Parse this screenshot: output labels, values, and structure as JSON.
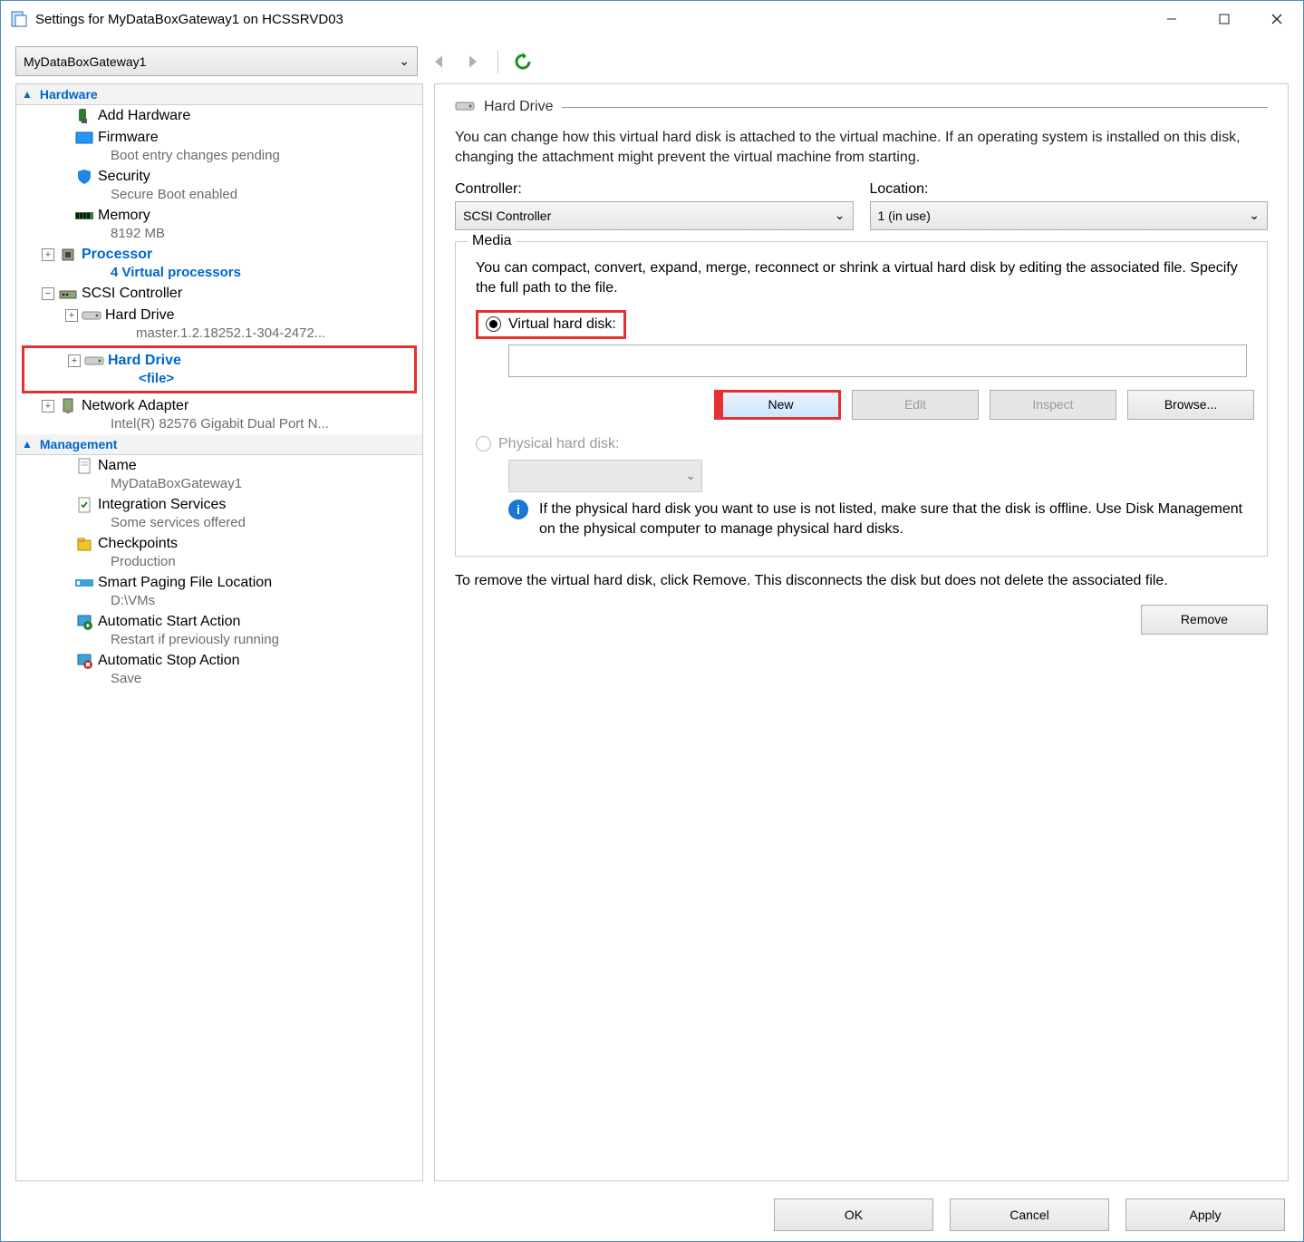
{
  "window": {
    "title": "Settings for MyDataBoxGateway1 on HCSSRVD03"
  },
  "toolbar": {
    "vm_name": "MyDataBoxGateway1"
  },
  "nav": {
    "hardware_header": "Hardware",
    "management_header": "Management",
    "items": {
      "add_hardware": {
        "label": "Add Hardware"
      },
      "firmware": {
        "label": "Firmware",
        "sub": "Boot entry changes pending"
      },
      "security": {
        "label": "Security",
        "sub": "Secure Boot enabled"
      },
      "memory": {
        "label": "Memory",
        "sub": "8192 MB"
      },
      "processor": {
        "label": "Processor",
        "sub": "4 Virtual processors"
      },
      "scsi": {
        "label": "SCSI Controller"
      },
      "hd1": {
        "label": "Hard Drive",
        "sub": "master.1.2.18252.1-304-2472..."
      },
      "hd2": {
        "label": "Hard Drive",
        "sub": "<file>"
      },
      "netadapter": {
        "label": "Network Adapter",
        "sub": "Intel(R) 82576 Gigabit Dual Port N..."
      },
      "name": {
        "label": "Name",
        "sub": "MyDataBoxGateway1"
      },
      "integration": {
        "label": "Integration Services",
        "sub": "Some services offered"
      },
      "checkpoints": {
        "label": "Checkpoints",
        "sub": "Production"
      },
      "paging": {
        "label": "Smart Paging File Location",
        "sub": "D:\\VMs"
      },
      "autostart": {
        "label": "Automatic Start Action",
        "sub": "Restart if previously running"
      },
      "autostop": {
        "label": "Automatic Stop Action",
        "sub": "Save"
      }
    }
  },
  "detail": {
    "title": "Hard Drive",
    "desc": "You can change how this virtual hard disk is attached to the virtual machine. If an operating system is installed on this disk, changing the attachment might prevent the virtual machine from starting.",
    "controller_label": "Controller:",
    "controller_value": "SCSI Controller",
    "location_label": "Location:",
    "location_value": "1 (in use)",
    "media_legend": "Media",
    "media_desc": "You can compact, convert, expand, merge, reconnect or shrink a virtual hard disk by editing the associated file. Specify the full path to the file.",
    "vhd_radio": "Virtual hard disk:",
    "phys_radio": "Physical hard disk:",
    "new_btn": "New",
    "edit_btn": "Edit",
    "inspect_btn": "Inspect",
    "browse_btn": "Browse...",
    "info_text": "If the physical hard disk you want to use is not listed, make sure that the disk is offline. Use Disk Management on the physical computer to manage physical hard disks.",
    "remove_desc": "To remove the virtual hard disk, click Remove. This disconnects the disk but does not delete the associated file.",
    "remove_btn": "Remove"
  },
  "footer": {
    "ok": "OK",
    "cancel": "Cancel",
    "apply": "Apply"
  }
}
